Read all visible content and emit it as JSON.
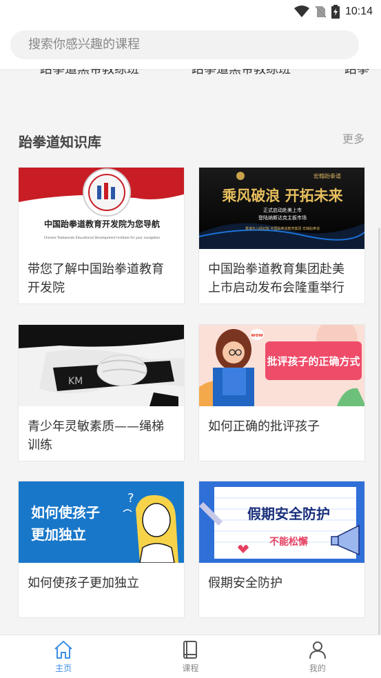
{
  "status": {
    "time": "10:14"
  },
  "search": {
    "placeholder": "搜索你感兴趣的课程"
  },
  "cut_row": [
    "跆拳道黑带教练班",
    "跆拳道黑带教练班",
    "跆拳"
  ],
  "section": {
    "title": "跆拳道知识库",
    "more": "更多"
  },
  "cards": [
    {
      "title": "带您了解中国跆拳道教育开发院",
      "image_caption": "中国跆拳道教育开发院为您导航",
      "image_sub": "Chinese Taekwondo Educational Development Institute for your navigation"
    },
    {
      "title": "中国跆拳道教育集团赴美上市启动发布会隆重举行",
      "image_caption": "乘风破浪 开拓未来",
      "image_line1": "正式启动赴美上市",
      "image_line2": "登陆纳斯达克主板市场",
      "image_footer": "香港杰儿经纪院    中国跆拳道教育集团    宏翰跆拳道",
      "image_logo": "宏翰跆拳道"
    },
    {
      "title": "青少年灵敏素质——绳梯训练",
      "image_text": "KM"
    },
    {
      "title": "如何正确的批评孩子",
      "image_caption": "批评孩子的正确方式",
      "image_bubble": "wow"
    },
    {
      "title": "如何使孩子更加独立",
      "image_line1": "如何使孩子",
      "image_line2": "更加独立"
    },
    {
      "title": "假期安全防护",
      "image_line1": "假期安全防护",
      "image_line2": "不能松懈"
    }
  ],
  "nav": [
    {
      "label": "主页",
      "icon": "home-icon",
      "active": true
    },
    {
      "label": "课程",
      "icon": "book-icon",
      "active": false
    },
    {
      "label": "我的",
      "icon": "user-icon",
      "active": false
    }
  ],
  "colors": {
    "accent": "#3a8ee6",
    "card_red": "#c81d25",
    "blue_bg": "#1877c9"
  }
}
